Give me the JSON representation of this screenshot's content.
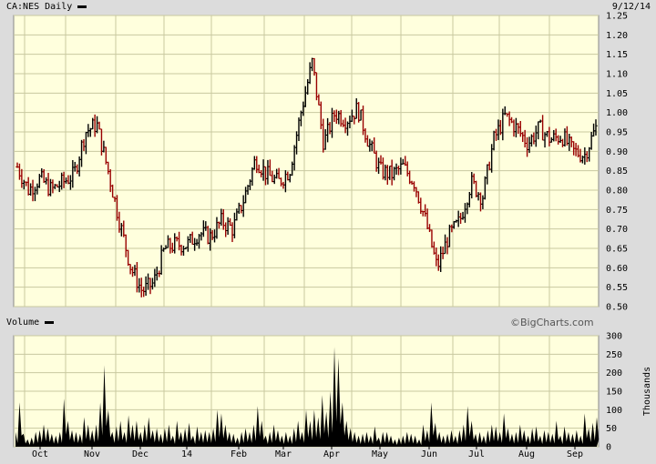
{
  "header": {
    "symbol_label": "CA:NES Daily",
    "date": "9/12/14"
  },
  "volume_header": {
    "label": "Volume"
  },
  "watermark": "©BigCharts.com",
  "chart_data": [
    {
      "type": "ohlc",
      "title": "CA:NES Daily",
      "ylim": [
        0.5,
        1.25
      ],
      "y_ticks": [
        "1.25",
        "1.20",
        "1.15",
        "1.10",
        "1.05",
        "1.00",
        "0.95",
        "0.90",
        "0.85",
        "0.80",
        "0.75",
        "0.70",
        "0.65",
        "0.60",
        "0.55",
        "0.50"
      ],
      "x_ticks": [
        "Oct",
        "Nov",
        "Dec",
        "14",
        "Feb",
        "Mar",
        "Apr",
        "May",
        "Jun",
        "Jul",
        "Aug",
        "Sep"
      ],
      "grid": true,
      "colors": {
        "background": "#ffffdd",
        "grid": "#c8c8a0",
        "up": "#000000",
        "down": "#990000"
      },
      "close_points": [
        [
          "Sep 15",
          0.86
        ],
        [
          "Sep 22",
          0.8
        ],
        [
          "Sep 29",
          0.83
        ],
        [
          "Oct 6",
          0.8
        ],
        [
          "Oct 13",
          0.82
        ],
        [
          "Oct 20",
          0.84
        ],
        [
          "Oct 27",
          0.95
        ],
        [
          "Nov 3",
          0.97
        ],
        [
          "Nov 10",
          0.85
        ],
        [
          "Nov 17",
          0.72
        ],
        [
          "Nov 24",
          0.6
        ],
        [
          "Dec 1",
          0.54
        ],
        [
          "Dec 8",
          0.56
        ],
        [
          "Dec 15",
          0.65
        ],
        [
          "Dec 22",
          0.66
        ],
        [
          "Dec 29",
          0.66
        ],
        [
          "Jan 5",
          0.69
        ],
        [
          "Jan 12",
          0.68
        ],
        [
          "Jan 19",
          0.72
        ],
        [
          "Jan 26",
          0.7
        ],
        [
          "Feb 2",
          0.78
        ],
        [
          "Feb 9",
          0.88
        ],
        [
          "Feb 16",
          0.84
        ],
        [
          "Feb 23",
          0.82
        ],
        [
          "Mar 2",
          0.85
        ],
        [
          "Mar 9",
          1.0
        ],
        [
          "Mar 16",
          1.13
        ],
        [
          "Mar 23",
          0.92
        ],
        [
          "Mar 30",
          1.0
        ],
        [
          "Apr 6",
          0.98
        ],
        [
          "Apr 13",
          1.01
        ],
        [
          "Apr 20",
          0.92
        ],
        [
          "Apr 27",
          0.85
        ],
        [
          "May 4",
          0.84
        ],
        [
          "May 11",
          0.86
        ],
        [
          "May 18",
          0.82
        ],
        [
          "May 25",
          0.72
        ],
        [
          "Jun 1",
          0.6
        ],
        [
          "Jun 8",
          0.68
        ],
        [
          "Jun 15",
          0.72
        ],
        [
          "Jun 22",
          0.82
        ],
        [
          "Jun 29",
          0.78
        ],
        [
          "Jul 6",
          0.93
        ],
        [
          "Jul 13",
          0.99
        ],
        [
          "Jul 20",
          0.96
        ],
        [
          "Jul 27",
          0.92
        ],
        [
          "Aug 3",
          0.96
        ],
        [
          "Aug 10",
          0.93
        ],
        [
          "Aug 17",
          0.94
        ],
        [
          "Aug 24",
          0.9
        ],
        [
          "Aug 31",
          0.89
        ],
        [
          "Sep 7",
          0.96
        ]
      ]
    },
    {
      "type": "area",
      "title": "Volume",
      "ylabel": "Thousands",
      "ylim": [
        0,
        300
      ],
      "y_ticks": [
        "300",
        "250",
        "200",
        "150",
        "100",
        "50",
        "0"
      ],
      "x_ticks": [
        "Oct",
        "Nov",
        "Dec",
        "14",
        "Feb",
        "Mar",
        "Apr",
        "May",
        "Jun",
        "Jul",
        "Aug",
        "Sep"
      ],
      "grid": true,
      "values": [
        40,
        120,
        35,
        20,
        25,
        40,
        45,
        60,
        50,
        35,
        30,
        40,
        130,
        70,
        45,
        40,
        35,
        80,
        60,
        45,
        60,
        120,
        220,
        100,
        40,
        55,
        70,
        40,
        85,
        60,
        70,
        40,
        60,
        80,
        45,
        50,
        35,
        50,
        60,
        30,
        70,
        40,
        50,
        65,
        30,
        55,
        40,
        45,
        40,
        50,
        100,
        90,
        60,
        40,
        35,
        25,
        40,
        50,
        40,
        60,
        110,
        70,
        30,
        40,
        60,
        45,
        30,
        40,
        30,
        50,
        70,
        40,
        100,
        70,
        100,
        80,
        140,
        95,
        150,
        270,
        240,
        120,
        70,
        50,
        40,
        30,
        35,
        40,
        30,
        55,
        25,
        40,
        40,
        30,
        20,
        25,
        30,
        40,
        35,
        30,
        20,
        60,
        45,
        120,
        65,
        40,
        30,
        35,
        45,
        30,
        45,
        60,
        110,
        70,
        35,
        40,
        30,
        45,
        60,
        55,
        40,
        90,
        50,
        35,
        40,
        60,
        45,
        30,
        50,
        55,
        30,
        45,
        40,
        35,
        70,
        30,
        55,
        40,
        35,
        45,
        30,
        90,
        50,
        65,
        80
      ]
    }
  ]
}
